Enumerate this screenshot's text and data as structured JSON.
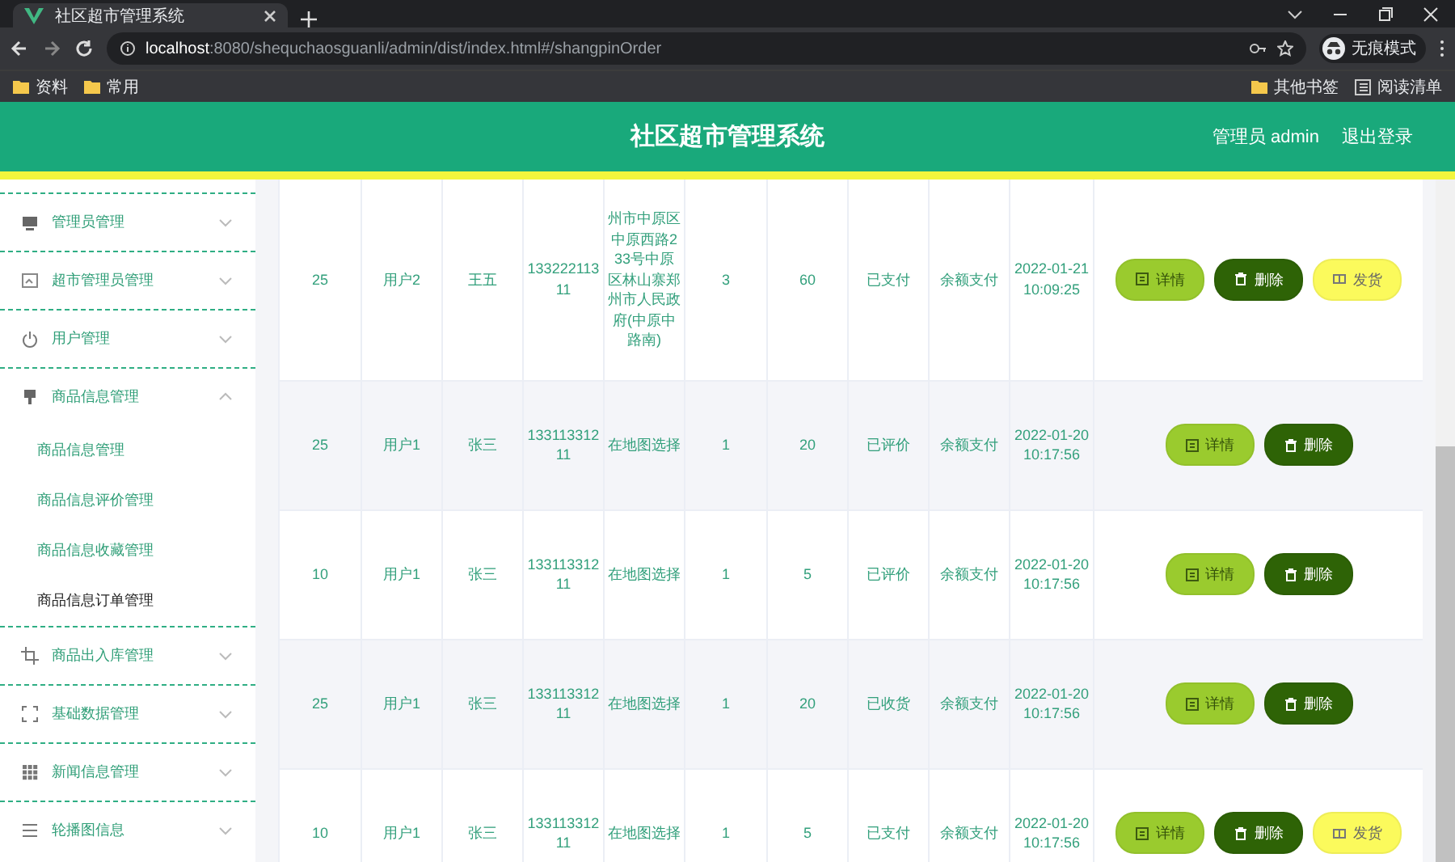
{
  "browser": {
    "tab_title": "社区超市管理系统",
    "url_host": "localhost",
    "url_path": ":8080/shequchaosguanli/admin/dist/index.html#/shangpinOrder",
    "profile": "无痕模式",
    "bookmarks": [
      "资料",
      "常用"
    ],
    "bookmarks_right": [
      "其他书签",
      "阅读清单"
    ]
  },
  "header": {
    "title": "社区超市管理系统",
    "user": "管理员 admin",
    "logout": "退出登录"
  },
  "sidebar": {
    "items": [
      {
        "label": "管理员管理",
        "expanded": false
      },
      {
        "label": "超市管理员管理",
        "expanded": false
      },
      {
        "label": "用户管理",
        "expanded": false
      },
      {
        "label": "商品信息管理",
        "expanded": true,
        "children": [
          {
            "label": "商品信息管理",
            "selected": false
          },
          {
            "label": "商品信息评价管理",
            "selected": false
          },
          {
            "label": "商品信息收藏管理",
            "selected": false
          },
          {
            "label": "商品信息订单管理",
            "selected": true
          }
        ]
      },
      {
        "label": "商品出入库管理",
        "expanded": false
      },
      {
        "label": "基础数据管理",
        "expanded": false
      },
      {
        "label": "新闻信息管理",
        "expanded": false
      },
      {
        "label": "轮播图信息",
        "expanded": false
      }
    ]
  },
  "table": {
    "rows": [
      {
        "cells": [
          "25",
          "用户2",
          "王五",
          "13322211311",
          "州市中原区中原西路233号中原区林山寨郑州市人民政府(中原中路南)",
          "3",
          "60",
          "已支付",
          "余额支付",
          "2022-01-21 10:09:25"
        ],
        "actions": [
          {
            "label": "详情",
            "kind": "detail"
          },
          {
            "label": "删除",
            "kind": "delete"
          },
          {
            "label": "发货",
            "kind": "ship"
          }
        ]
      },
      {
        "cells": [
          "25",
          "用户1",
          "张三",
          "13311331211",
          "在地图选择",
          "1",
          "20",
          "已评价",
          "余额支付",
          "2022-01-20 10:17:56"
        ],
        "actions": [
          {
            "label": "详情",
            "kind": "detail"
          },
          {
            "label": "删除",
            "kind": "delete"
          }
        ]
      },
      {
        "cells": [
          "10",
          "用户1",
          "张三",
          "13311331211",
          "在地图选择",
          "1",
          "5",
          "已评价",
          "余额支付",
          "2022-01-20 10:17:56"
        ],
        "actions": [
          {
            "label": "详情",
            "kind": "detail"
          },
          {
            "label": "删除",
            "kind": "delete"
          }
        ]
      },
      {
        "cells": [
          "25",
          "用户1",
          "张三",
          "13311331211",
          "在地图选择",
          "1",
          "20",
          "已收货",
          "余额支付",
          "2022-01-20 10:17:56"
        ],
        "actions": [
          {
            "label": "详情",
            "kind": "detail"
          },
          {
            "label": "删除",
            "kind": "delete"
          }
        ]
      },
      {
        "cells": [
          "10",
          "用户1",
          "张三",
          "13311331211",
          "在地图选择",
          "1",
          "5",
          "已支付",
          "余额支付",
          "2022-01-20 10:17:56"
        ],
        "actions": [
          {
            "label": "详情",
            "kind": "detail"
          },
          {
            "label": "删除",
            "kind": "delete"
          },
          {
            "label": "发货",
            "kind": "ship"
          }
        ]
      }
    ]
  }
}
